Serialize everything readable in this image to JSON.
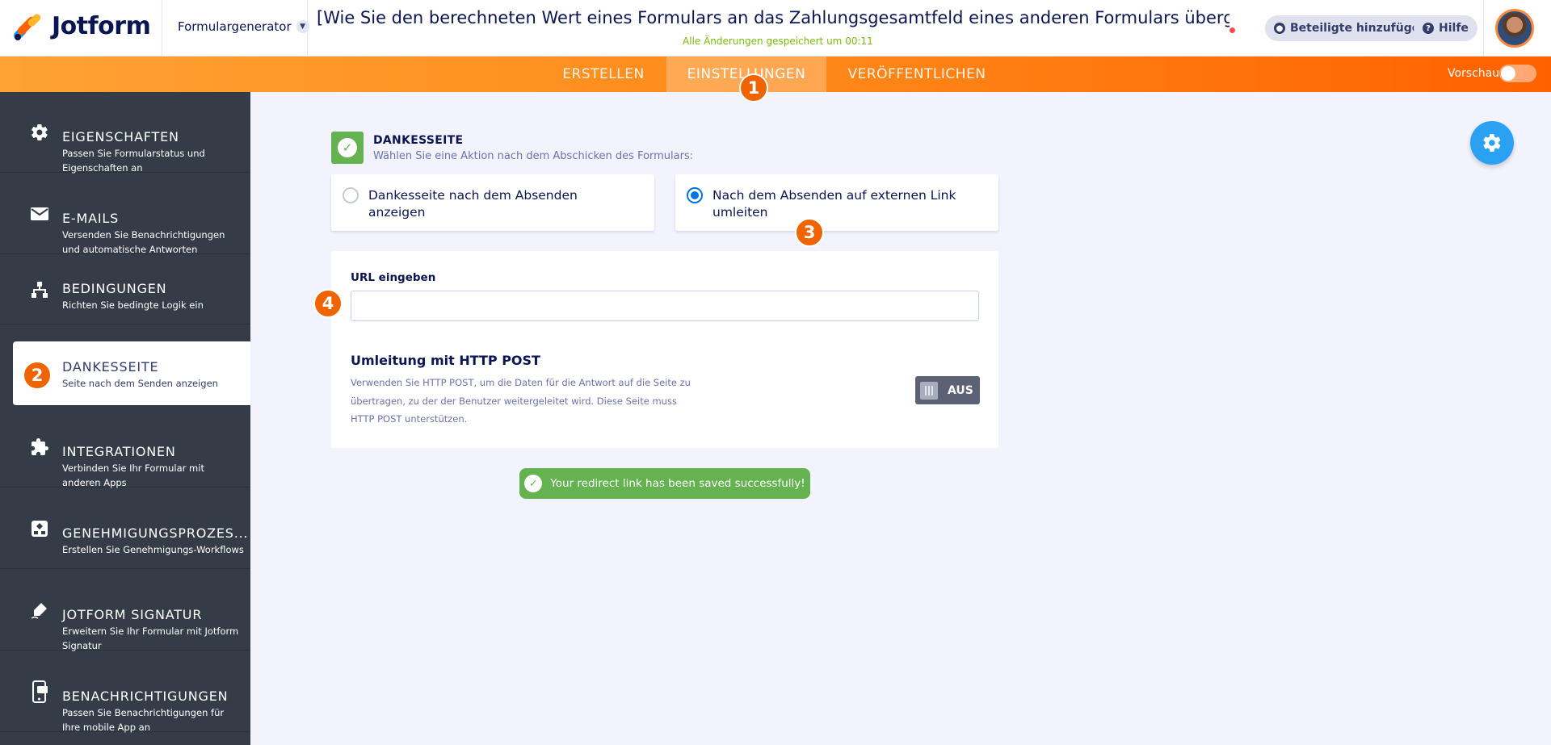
{
  "header": {
    "logo_text": "Jotform",
    "generator_label": "Formulargenerator",
    "form_title": "[Wie Sie den berechneten Wert eines Formulars an das Zahlungsgesamtfeld eines anderen Formulars übergeben - Berech...",
    "saved_status": "Alle Änderungen gespeichert um 00:11",
    "add_participants_label": "Beteiligte hinzufügen",
    "help_label": "Hilfe"
  },
  "nav": {
    "tabs": [
      {
        "label": "ERSTELLEN",
        "active": false
      },
      {
        "label": "EINSTELLUNGEN",
        "active": true
      },
      {
        "label": "VERÖFFENTLICHEN",
        "active": false
      }
    ],
    "preview_label": "Vorschau",
    "preview_on": false
  },
  "sidebar": {
    "items": [
      {
        "title": "EIGENSCHAFTEN",
        "desc": "Passen Sie Formularstatus und Eigenschaften an",
        "icon": "gear-icon"
      },
      {
        "title": "E-MAILS",
        "desc": "Versenden Sie Benachrichtigungen und automatische Antworten",
        "icon": "envelope-icon"
      },
      {
        "title": "BEDINGUNGEN",
        "desc": "Richten Sie bedingte Logik ein",
        "icon": "hierarchy-icon"
      },
      {
        "title": "DANKESSEITE",
        "desc": "Seite nach dem Senden anzeigen",
        "icon": "check-icon",
        "active": true
      },
      {
        "title": "INTEGRATIONEN",
        "desc": "Verbinden Sie Ihr Formular mit anderen Apps",
        "icon": "puzzle-icon"
      },
      {
        "title": "GENEHMIGUNGSPROZES...",
        "desc": "Erstellen Sie Genehmigungs-Workflows",
        "icon": "workflow-icon"
      },
      {
        "title": "JOTFORM SIGNATUR",
        "desc": "Erweitern Sie Ihr Formular mit Jotform Signatur",
        "icon": "pen-icon"
      },
      {
        "title": "BENACHRICHTIGUNGEN",
        "desc": "Passen Sie Benachrichtigungen für Ihre mobile App an",
        "icon": "mobile-icon"
      }
    ]
  },
  "badges": [
    "1",
    "2",
    "3",
    "4"
  ],
  "main": {
    "section_title": "DANKESSEITE",
    "section_desc": "Wählen Sie eine Aktion nach dem Abschicken des Formulars:",
    "options": [
      {
        "label": "Dankesseite nach dem Absenden anzeigen",
        "selected": false
      },
      {
        "label": "Nach dem Absenden auf externen Link umleiten",
        "selected": true
      }
    ],
    "url_label": "URL eingeben",
    "url_value": "",
    "post_title": "Umleitung mit HTTP POST",
    "post_desc": "Verwenden Sie HTTP POST, um die Daten für die Antwort auf die Seite zu übertragen, zu der der Benutzer weitergeleitet wird. Diese Seite muss HTTP POST unterstützen.",
    "post_toggle_label": "AUS",
    "post_toggle_on": false,
    "toast": "Your redirect link has been saved successfully!"
  },
  "colors": {
    "accent_orange": "#ff6100",
    "badge_orange": "#f06400",
    "success_green": "#64b250",
    "sidebar_bg": "#343c47",
    "fab_blue": "#2aa1f3",
    "radio_blue": "#0075e3"
  }
}
